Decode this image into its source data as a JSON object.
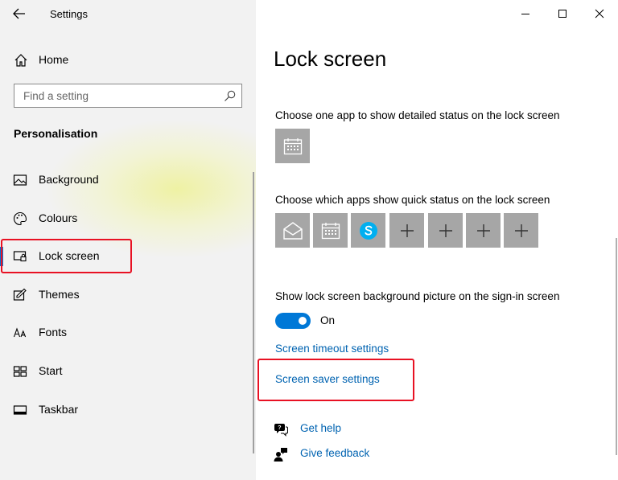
{
  "window": {
    "title": "Settings",
    "controls": [
      "minimize-icon",
      "maximize-icon",
      "close-icon"
    ]
  },
  "sidebar": {
    "home_label": "Home",
    "search_placeholder": "Find a setting",
    "section_heading": "Personalisation",
    "items": [
      {
        "label": "Background",
        "icon": "picture-icon"
      },
      {
        "label": "Colours",
        "icon": "palette-icon"
      },
      {
        "label": "Lock screen",
        "icon": "lock-screen-icon",
        "active": true
      },
      {
        "label": "Themes",
        "icon": "themes-icon"
      },
      {
        "label": "Fonts",
        "icon": "fonts-icon"
      },
      {
        "label": "Start",
        "icon": "start-icon"
      },
      {
        "label": "Taskbar",
        "icon": "taskbar-icon"
      }
    ]
  },
  "main": {
    "title": "Lock screen",
    "detailed_status_label": "Choose one app to show detailed status on the lock screen",
    "detailed_status_app": "calendar-icon",
    "quick_status_label": "Choose which apps show quick status on the lock screen",
    "quick_status_apps": [
      "mail-icon",
      "calendar-icon",
      "skype-icon",
      "add-icon",
      "add-icon",
      "add-icon",
      "add-icon"
    ],
    "signin_bg_label": "Show lock screen background picture on the sign-in screen",
    "toggle_state": "On",
    "toggle_on": true,
    "screen_timeout_link": "Screen timeout settings",
    "screen_saver_link": "Screen saver settings",
    "get_help": "Get help",
    "give_feedback": "Give feedback"
  },
  "colors": {
    "accent": "#0078d7",
    "link": "#0063b1",
    "highlight": "#e81123",
    "tile": "#a6a6a6"
  }
}
